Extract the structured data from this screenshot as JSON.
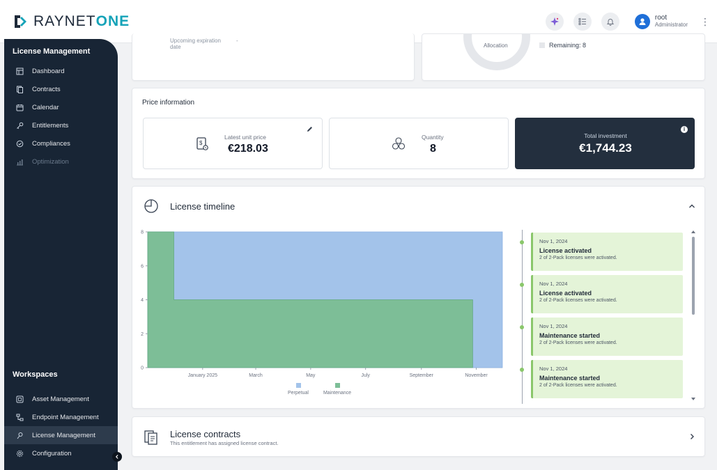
{
  "app": {
    "logo_left": "RAYNET",
    "logo_right": "ONE"
  },
  "topbar": {
    "user_name": "root",
    "user_role": "Administrator"
  },
  "sidebar": {
    "section_title": "License Management",
    "items": [
      {
        "label": "Dashboard",
        "icon": "dashboard-icon"
      },
      {
        "label": "Contracts",
        "icon": "contracts-icon"
      },
      {
        "label": "Calendar",
        "icon": "calendar-icon"
      },
      {
        "label": "Entitlements",
        "icon": "entitlements-icon"
      },
      {
        "label": "Compliances",
        "icon": "compliances-icon"
      },
      {
        "label": "Optimization",
        "icon": "optimization-icon",
        "disabled": true
      }
    ],
    "workspaces_title": "Workspaces",
    "workspaces": [
      {
        "label": "Asset Management"
      },
      {
        "label": "Endpoint Management"
      },
      {
        "label": "License Management",
        "active": true
      },
      {
        "label": "Configuration"
      }
    ]
  },
  "top_cards": {
    "expiration_label": "Upcoming expiration date",
    "expiration_value": "-",
    "allocation_label": "Allocation",
    "remaining_label": "Remaining: 8"
  },
  "price": {
    "title": "Price information",
    "unit_price_label": "Latest unit price",
    "unit_price_value": "€218.03",
    "quantity_label": "Quantity",
    "quantity_value": "8",
    "total_label": "Total investment",
    "total_value": "€1,744.23"
  },
  "timeline": {
    "title": "License timeline",
    "events": [
      {
        "date": "Nov 1, 2024",
        "title": "License activated",
        "desc": "2 of 2-Pack licenses were activated."
      },
      {
        "date": "Nov 1, 2024",
        "title": "License activated",
        "desc": "2 of 2-Pack licenses were activated."
      },
      {
        "date": "Nov 1, 2024",
        "title": "Maintenance started",
        "desc": "2 of 2-Pack licenses were activated."
      },
      {
        "date": "Nov 1, 2024",
        "title": "Maintenance started",
        "desc": "2 of 2-Pack licenses were activated."
      }
    ]
  },
  "chart_data": {
    "type": "area",
    "x_tick_labels": [
      "January 2025",
      "March",
      "May",
      "July",
      "September",
      "November"
    ],
    "y_ticks": [
      0,
      2,
      4,
      6,
      8
    ],
    "ylim": [
      0,
      8
    ],
    "xlim": [
      "2024-11-01",
      "2025-11-30"
    ],
    "legend_position": "bottom",
    "series": [
      {
        "name": "Perpetual",
        "color": "#a3c3ea",
        "points": [
          [
            "2024-11-01",
            8
          ],
          [
            "2025-11-30",
            8
          ]
        ]
      },
      {
        "name": "Maintenance",
        "color": "#7dbe97",
        "points": [
          [
            "2024-11-01",
            8
          ],
          [
            "2024-11-30",
            8
          ],
          [
            "2024-11-30",
            4
          ],
          [
            "2025-10-28",
            4
          ],
          [
            "2025-10-28",
            0
          ]
        ]
      }
    ]
  },
  "contracts": {
    "title": "License contracts",
    "subtitle": "This entitlement has assigned license contract."
  }
}
